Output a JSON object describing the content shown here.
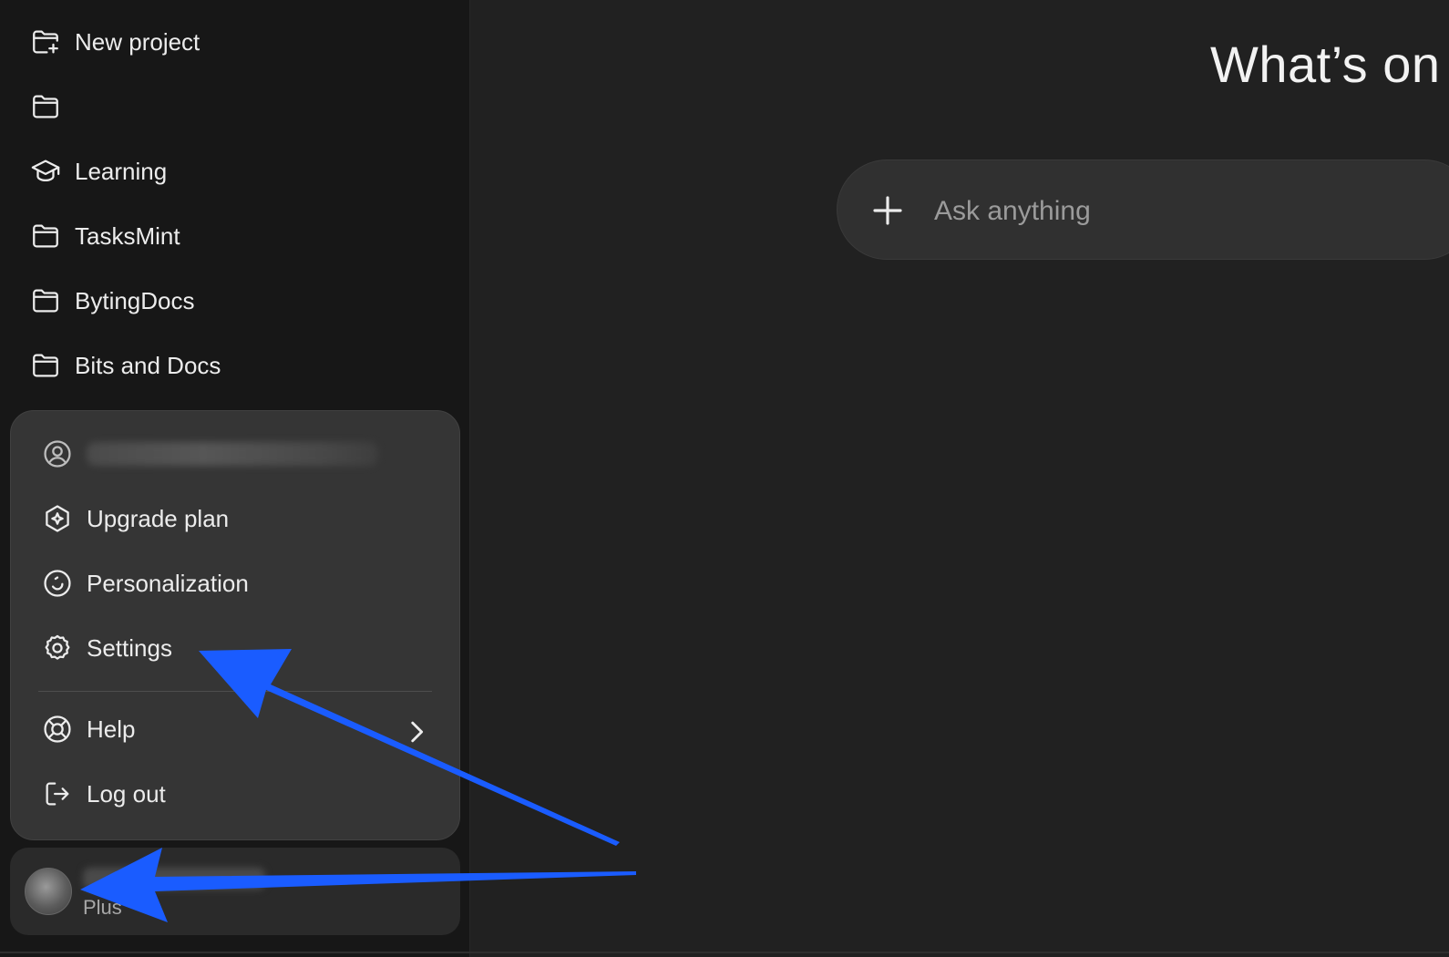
{
  "sidebar": {
    "items": [
      {
        "label": "New project",
        "icon": "folder-plus-icon"
      },
      {
        "label": "",
        "icon": "folder-icon"
      },
      {
        "label": "Learning",
        "icon": "graduation-cap-icon"
      },
      {
        "label": "TasksMint",
        "icon": "folder-icon"
      },
      {
        "label": "BytingDocs",
        "icon": "folder-icon"
      },
      {
        "label": "Bits and Docs",
        "icon": "folder-icon"
      }
    ]
  },
  "account_menu": {
    "email_icon": "user-circle-icon",
    "items": [
      {
        "label": "Upgrade plan",
        "icon": "upgrade-sparkle-icon"
      },
      {
        "label": "Personalization",
        "icon": "personalization-icon"
      },
      {
        "label": "Settings",
        "icon": "gear-icon"
      },
      {
        "label": "Help",
        "icon": "lifebuoy-icon",
        "submenu": true
      },
      {
        "label": "Log out",
        "icon": "logout-icon"
      }
    ]
  },
  "user": {
    "plan": "Plus",
    "avatar": "avatar-photo"
  },
  "main": {
    "title": "What’s on t",
    "composer": {
      "placeholder": "Ask anything",
      "add_icon": "plus-icon"
    }
  },
  "annotations": {
    "arrow_color": "#1a5cff",
    "arrows": [
      "arrow-to-settings",
      "arrow-to-profile"
    ]
  },
  "colors": {
    "background": "#212121",
    "sidebar": "#171717",
    "menu": "#353535",
    "text": "#ececec",
    "muted": "#9b9b9b",
    "annotation_arrow": "#1a5cff"
  }
}
